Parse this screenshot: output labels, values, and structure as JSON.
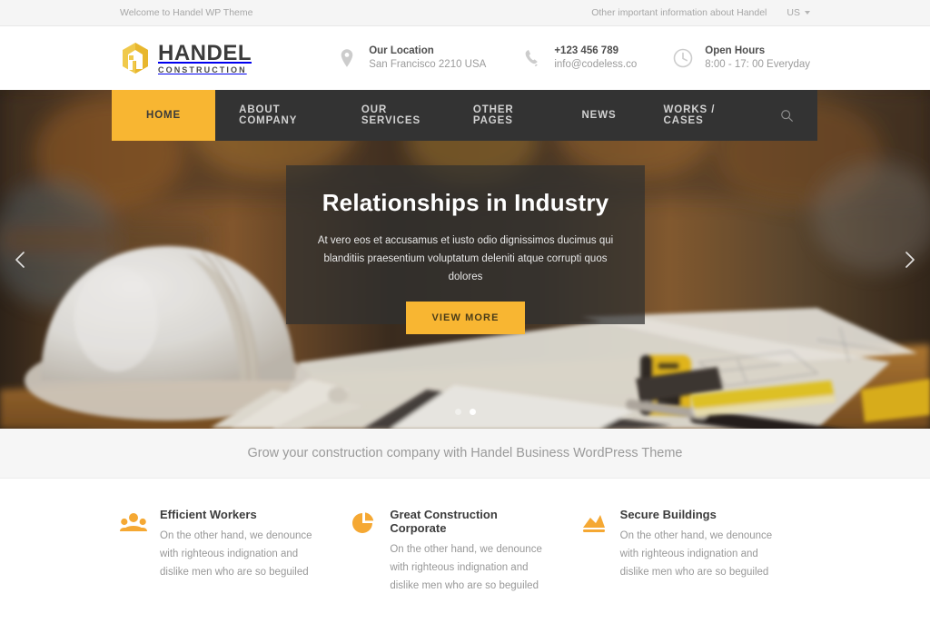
{
  "topbar": {
    "welcome": "Welcome to Handel WP Theme",
    "info": "Other important information about Handel",
    "language": "US"
  },
  "brand": {
    "name": "HANDEL",
    "tagline": "CONSTRUCTION",
    "accent_color": "#f8b632",
    "logo_icon": "house-logo-icon"
  },
  "contacts": [
    {
      "icon": "location-pin-icon",
      "title": "Our Location",
      "value": "San Francisco 2210 USA"
    },
    {
      "icon": "phone-icon",
      "title": "+123 456 789",
      "value": "info@codeless.co"
    },
    {
      "icon": "clock-icon",
      "title": "Open Hours",
      "value": "8:00 - 17: 00 Everyday"
    }
  ],
  "nav": {
    "items": [
      {
        "label": "HOME",
        "active": true
      },
      {
        "label": "ABOUT COMPANY",
        "active": false
      },
      {
        "label": "OUR SERVICES",
        "active": false
      },
      {
        "label": "OTHER PAGES",
        "active": false
      },
      {
        "label": "NEWS",
        "active": false
      },
      {
        "label": "WORKS / CASES",
        "active": false
      }
    ],
    "search_icon": "search-icon"
  },
  "hero": {
    "title": "Relationships in Industry",
    "description": "At vero eos et accusamus et iusto odio dignissimos ducimus qui blanditiis praesentium voluptatum deleniti atque corrupti quos dolores",
    "button": "VIEW MORE",
    "prev_icon": "chevron-left-icon",
    "next_icon": "chevron-right-icon",
    "slides_total": 2,
    "slide_active": 2
  },
  "tagline": {
    "text": "Grow your construction company with Handel Business WordPress Theme"
  },
  "features": [
    {
      "icon": "people-group-icon",
      "title": "Efficient Workers",
      "text": "On the other hand, we denounce with righteous indignation and dislike men who are so beguiled"
    },
    {
      "icon": "pie-segment-icon",
      "title": "Great  Construction Corporate",
      "text": "On the other hand, we denounce with righteous indignation and dislike men who are so beguiled"
    },
    {
      "icon": "mountain-chart-icon",
      "title": "Secure Buildings",
      "text": "On the other hand, we denounce with righteous indignation and dislike men who are so beguiled"
    }
  ]
}
